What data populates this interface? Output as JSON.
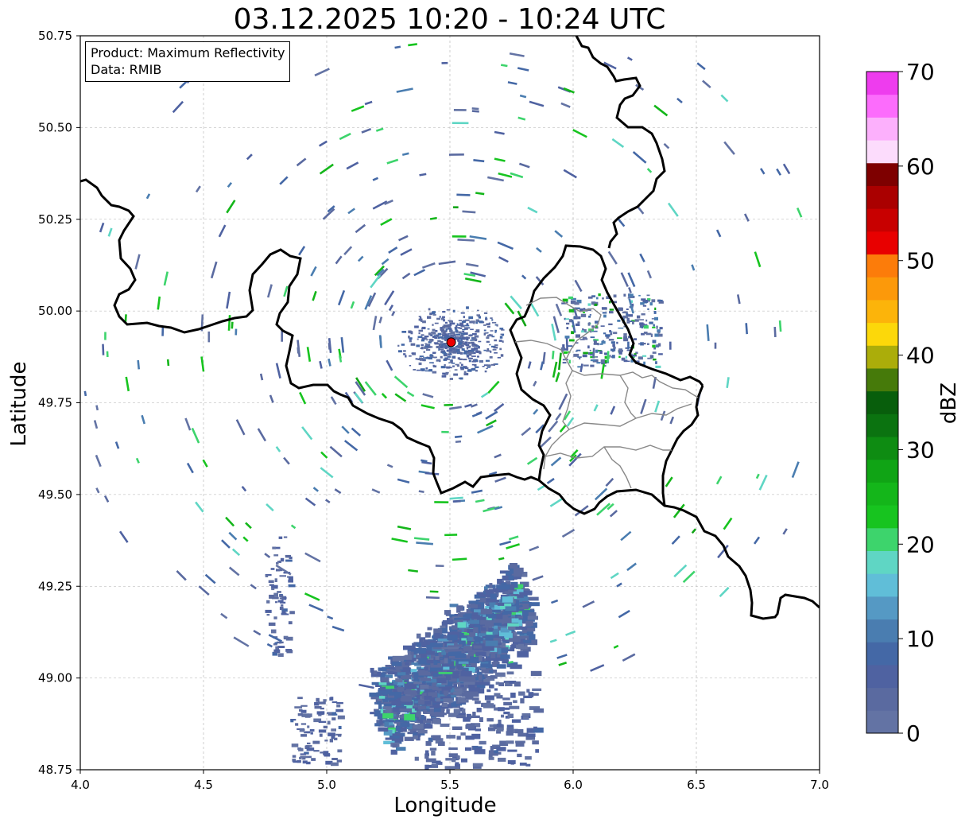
{
  "title": "03.12.2025 10:20 - 10:24 UTC",
  "info": {
    "product": "Product: Maximum Reflectivity",
    "source": "Data: RMIB"
  },
  "chart_data": {
    "type": "heatmap",
    "title": "03.12.2025 10:20 - 10:24 UTC",
    "xlabel": "Longitude",
    "ylabel": "Latitude",
    "xlim": [
      4.0,
      7.0
    ],
    "ylim": [
      48.75,
      50.75
    ],
    "xticks": [
      "4.0",
      "4.5",
      "5.0",
      "5.5",
      "6.0",
      "6.5",
      "7.0"
    ],
    "yticks": [
      "48.75",
      "49.00",
      "49.25",
      "49.50",
      "49.75",
      "50.00",
      "50.25",
      "50.50",
      "50.75"
    ],
    "grid": true,
    "radar_site": {
      "lon": 5.505,
      "lat": 49.915
    },
    "colorbar": {
      "label": "dBZ",
      "ticks": [
        "0",
        "10",
        "20",
        "30",
        "40",
        "50",
        "60",
        "70"
      ],
      "min": 0,
      "max": 70,
      "step": 2.5,
      "colors": [
        "#6373a4",
        "#5a6aa0",
        "#4f62a1",
        "#4468a6",
        "#4a7db0",
        "#5599c4",
        "#60bed8",
        "#5fd6c4",
        "#3dd46c",
        "#17c41f",
        "#14b61a",
        "#10a415",
        "#0e8c12",
        "#0b7310",
        "#085e0c",
        "#467a0a",
        "#abad0a",
        "#fcd80a",
        "#fcb40a",
        "#fc990a",
        "#fc7c0a",
        "#e80000",
        "#c80000",
        "#aa0000",
        "#7e0000",
        "#fcdcfc",
        "#fcb0fc",
        "#fc6cfc",
        "#ee3cee"
      ]
    },
    "precip_area": {
      "lon": [
        5.15,
        5.85
      ],
      "lat": [
        48.78,
        49.27
      ],
      "typical_dbz": [
        2,
        18
      ],
      "max_dbz": 22
    }
  }
}
